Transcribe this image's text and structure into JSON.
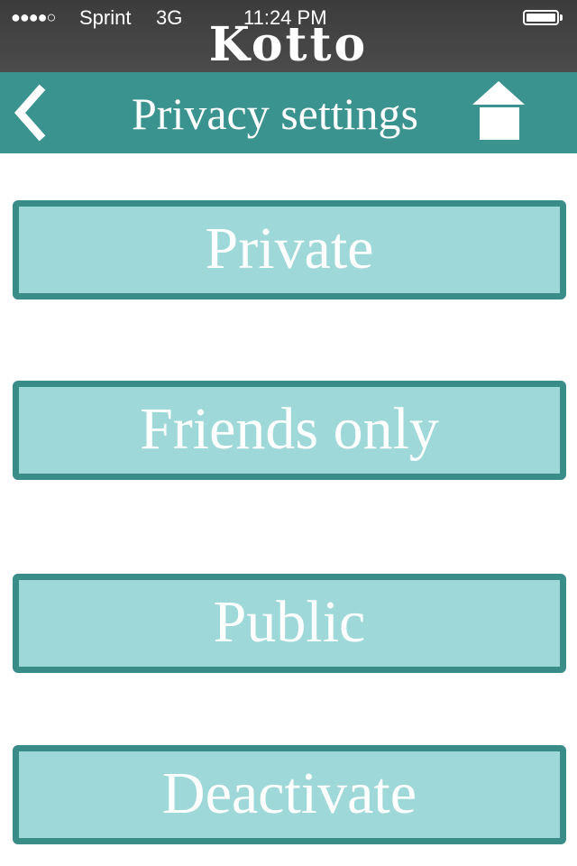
{
  "status_bar": {
    "signal": "●●●●○",
    "carrier": "Sprint",
    "network": "3G",
    "time": "11:24 PM",
    "battery_icon": "battery-icon"
  },
  "app": {
    "title": "Kotto"
  },
  "nav": {
    "title": "Privacy settings",
    "back_icon": "chevron-left-icon",
    "home_icon": "home-icon",
    "bar_color": "#3b9390"
  },
  "options": {
    "private_label": "Private",
    "friends_label": "Friends only",
    "public_label": "Public",
    "deactivate_label": "Deactivate",
    "fill_color": "#9ed8d8",
    "border_color": "#3a8c89"
  }
}
